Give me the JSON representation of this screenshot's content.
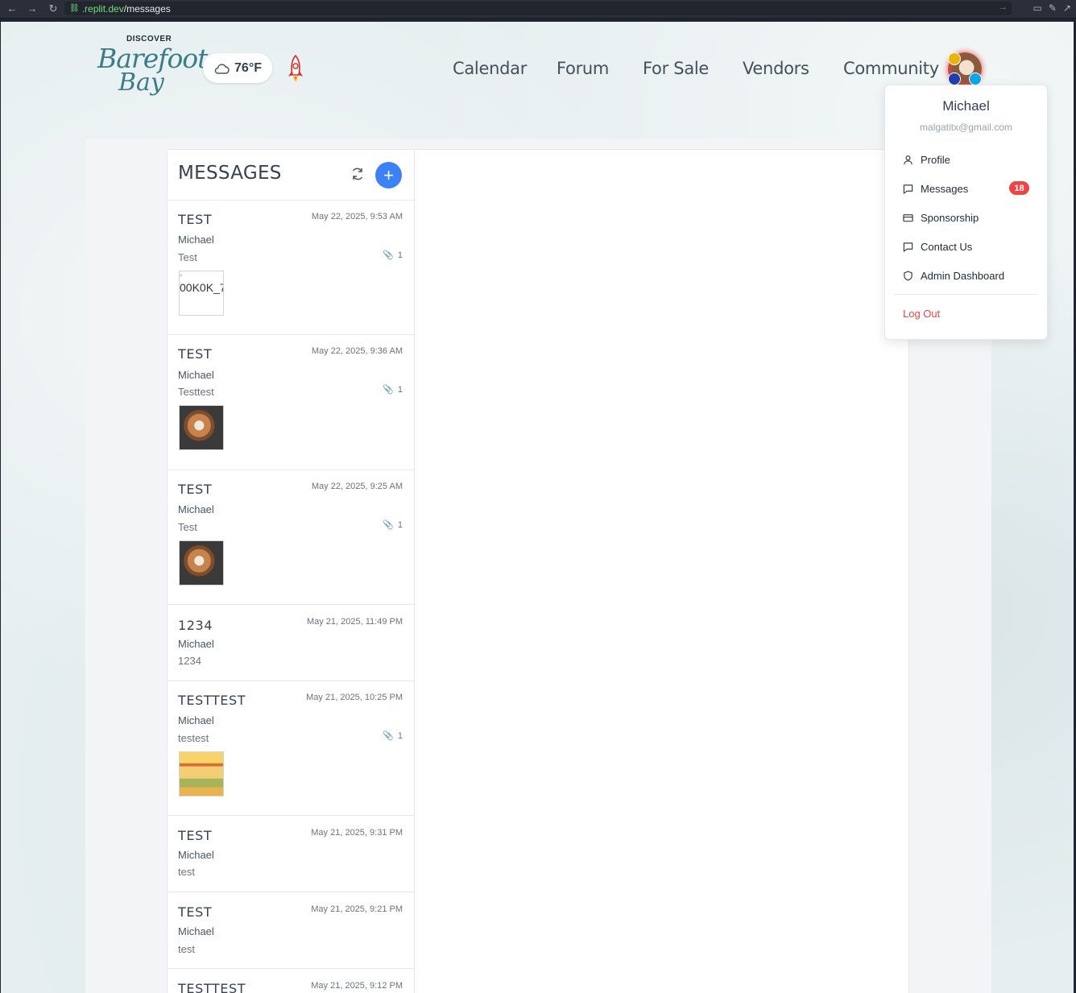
{
  "browser": {
    "url_domain": ".replit.dev",
    "url_path": "/messages"
  },
  "header": {
    "logo": {
      "top": "DISCOVER",
      "line1": "Barefoot",
      "line2": "Bay"
    },
    "weather": {
      "temp": "76°F",
      "icon": "cloud-icon"
    },
    "nav": [
      "Calendar",
      "Forum",
      "For Sale",
      "Vendors",
      "Community"
    ]
  },
  "messages_panel": {
    "title": "MESSAGES",
    "items": [
      {
        "subject": "TEST",
        "date": "May 22, 2025, 9:53 AM",
        "sender": "Michael",
        "preview": "Test",
        "attachments": "1",
        "thumb": "broken",
        "thumb_alt": "00K0K_7"
      },
      {
        "subject": "TEST",
        "date": "May 22, 2025, 9:36 AM",
        "sender": "Michael",
        "preview": "Testtest",
        "attachments": "1",
        "thumb": "dog"
      },
      {
        "subject": "TEST",
        "date": "May 22, 2025, 9:25 AM",
        "sender": "Michael",
        "preview": "Test",
        "attachments": "1",
        "thumb": "dog"
      },
      {
        "subject": "1234",
        "date": "May 21, 2025, 11:49 PM",
        "sender": "Michael",
        "preview": "1234"
      },
      {
        "subject": "TESTTEST",
        "date": "May 21, 2025, 10:25 PM",
        "sender": "Michael",
        "preview": "testest",
        "attachments": "1",
        "thumb": "poster"
      },
      {
        "subject": "TEST",
        "date": "May 21, 2025, 9:31 PM",
        "sender": "Michael",
        "preview": "test"
      },
      {
        "subject": "TEST",
        "date": "May 21, 2025, 9:21 PM",
        "sender": "Michael",
        "preview": "test"
      },
      {
        "subject": "TESTTEST",
        "date": "May 21, 2025, 9:12 PM",
        "sender": "",
        "preview": ""
      }
    ]
  },
  "user_menu": {
    "name": "Michael",
    "email": "malgatitx@gmail.com",
    "items": [
      {
        "label": "Profile",
        "icon": "user-icon"
      },
      {
        "label": "Messages",
        "icon": "message-icon",
        "badge": "18"
      },
      {
        "label": "Sponsorship",
        "icon": "card-icon"
      },
      {
        "label": "Contact Us",
        "icon": "message-icon"
      },
      {
        "label": "Admin Dashboard",
        "icon": "shield-icon"
      }
    ],
    "logout": "Log Out"
  },
  "colors": {
    "accent": "#3b82f6",
    "badge": "#ef4444",
    "logo": "#3a7d86"
  }
}
